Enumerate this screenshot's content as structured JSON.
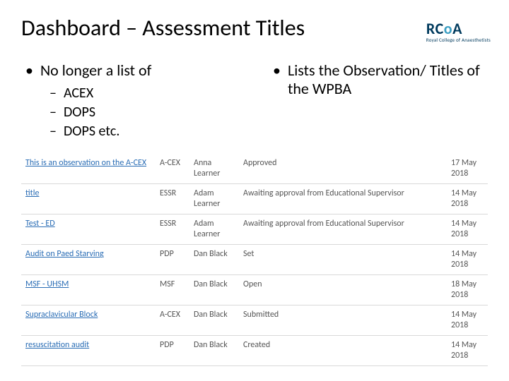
{
  "title": "Dashboard – Assessment Titles",
  "logo": {
    "text_pre": "RC",
    "text_accent": "o",
    "text_post": "A",
    "subtitle": "Royal College of Anaesthetists"
  },
  "left": {
    "heading": "No longer a list of",
    "items": [
      "ACEX",
      "DOPS",
      "DOPS etc."
    ]
  },
  "right": {
    "heading": "Lists the Observation/ Titles of the WPBA"
  },
  "rows": [
    {
      "title": "This is an observation on the A-CEX",
      "type": "A-CEX",
      "person": "Anna Learner",
      "status": "Approved",
      "date": "17 May 2018"
    },
    {
      "title": "title",
      "type": "ESSR",
      "person": "Adam Learner",
      "status": "Awaiting approval from Educational Supervisor",
      "date": "14 May 2018"
    },
    {
      "title": "Test - ED",
      "type": "ESSR",
      "person": "Adam Learner",
      "status": "Awaiting approval from Educational Supervisor",
      "date": "14 May 2018"
    },
    {
      "title": "Audit on Paed Starving",
      "type": "PDP",
      "person": "Dan Black",
      "status": "Set",
      "date": "14 May 2018"
    },
    {
      "title": "MSF - UHSM",
      "type": "MSF",
      "person": "Dan Black",
      "status": "Open",
      "date": "18 May 2018"
    },
    {
      "title": "Supraclavicular Block",
      "type": "A-CEX",
      "person": "Dan Black",
      "status": "Submitted",
      "date": "14 May 2018"
    },
    {
      "title": "resuscitation audit",
      "type": "PDP",
      "person": "Dan Black",
      "status": "Created",
      "date": "14 May 2018"
    }
  ]
}
